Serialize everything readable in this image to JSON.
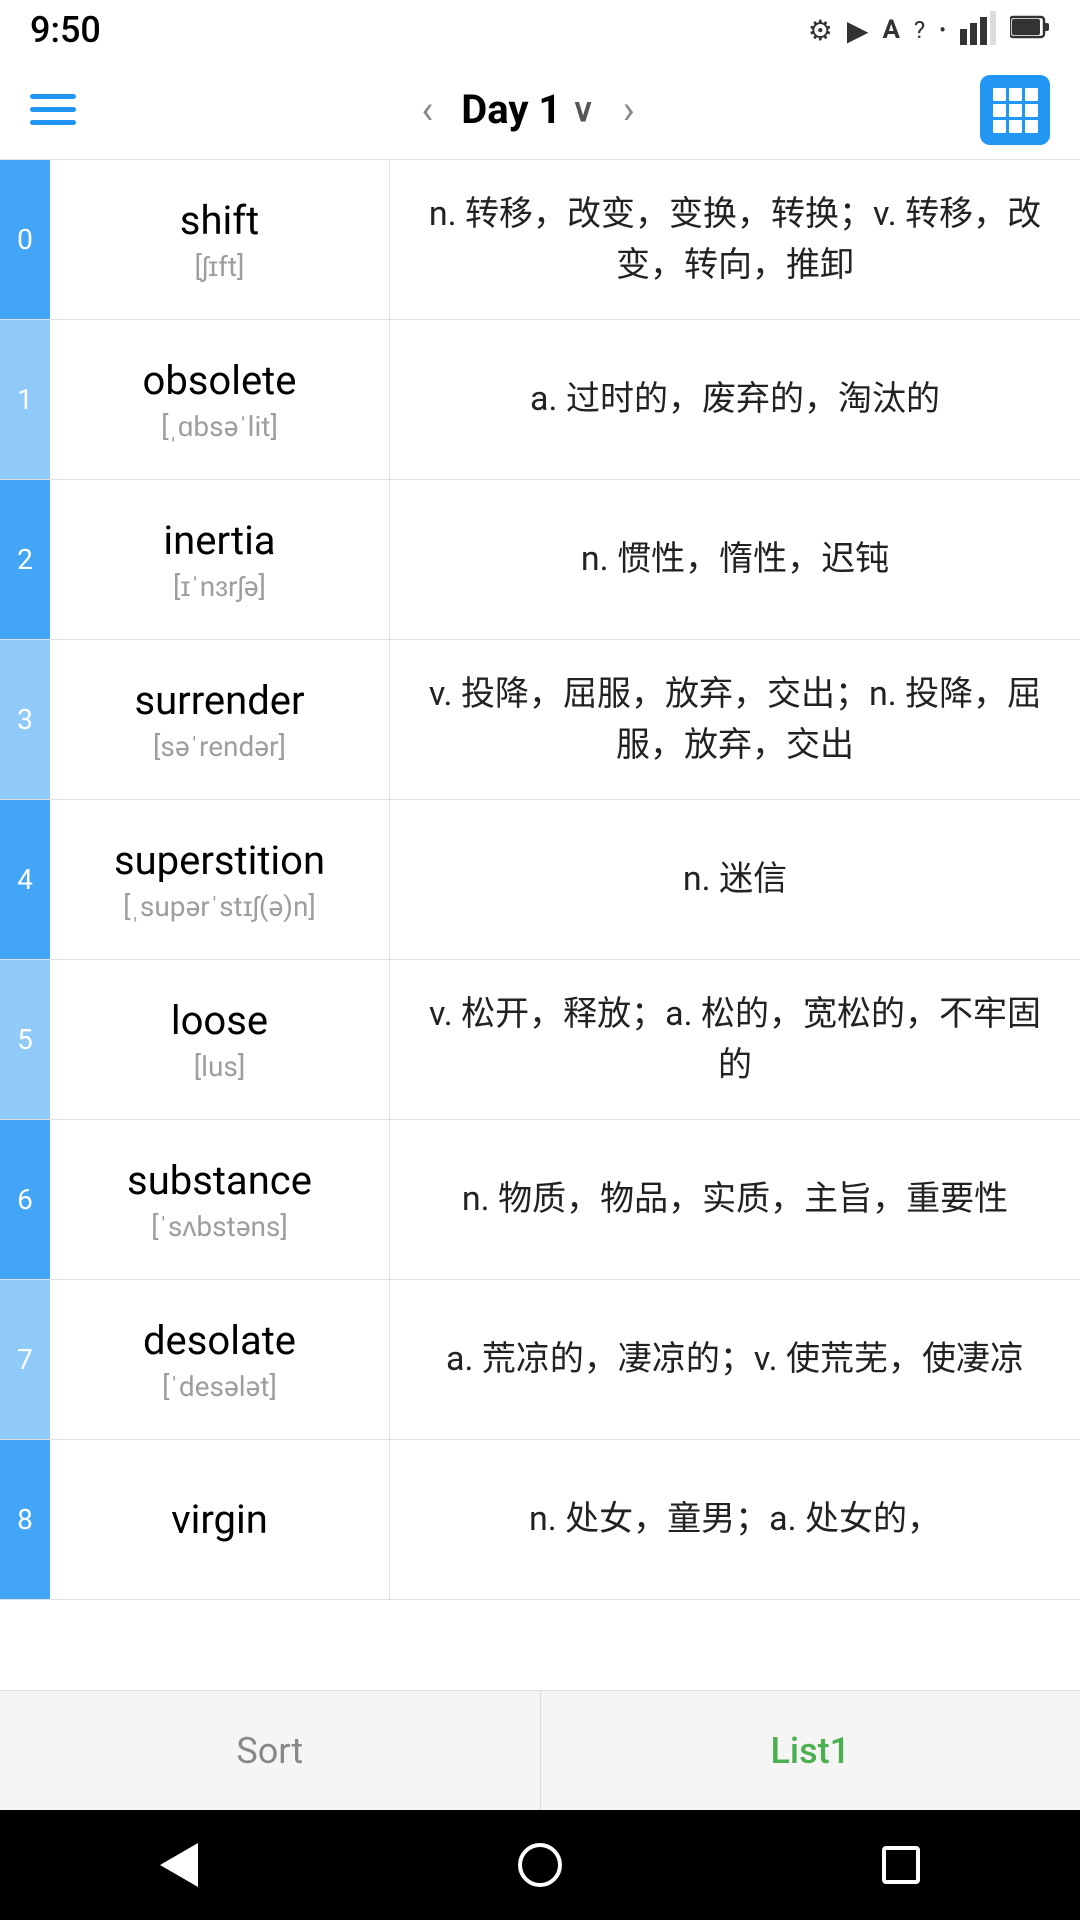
{
  "statusBar": {
    "time": "9:50",
    "icons": [
      "settings",
      "play-protect",
      "font",
      "wifi",
      "signal",
      "battery"
    ]
  },
  "navBar": {
    "title": "Day 1",
    "prevArrow": "‹",
    "nextArrow": "›"
  },
  "words": [
    {
      "index": "0",
      "word": "shift",
      "phonetic": "[ʃɪft]",
      "definition": "n. 转移，改变，变换，转换；v. 转移，改变，转向，推卸"
    },
    {
      "index": "1",
      "word": "obsolete",
      "phonetic": "[ˌɑbsəˈlit]",
      "definition": "a. 过时的，废弃的，淘汰的"
    },
    {
      "index": "2",
      "word": "inertia",
      "phonetic": "[ɪˈnɜrʃə]",
      "definition": "n. 惯性，惰性，迟钝"
    },
    {
      "index": "3",
      "word": "surrender",
      "phonetic": "[səˈrendər]",
      "definition": "v. 投降，屈服，放弃，交出；n. 投降，屈服，放弃，交出"
    },
    {
      "index": "4",
      "word": "superstition",
      "phonetic": "[ˌsupərˈstɪʃ(ə)n]",
      "definition": "n. 迷信"
    },
    {
      "index": "5",
      "word": "loose",
      "phonetic": "[lus]",
      "definition": "v. 松开，释放；a. 松的，宽松的，不牢固的"
    },
    {
      "index": "6",
      "word": "substance",
      "phonetic": "[ˈsʌbstəns]",
      "definition": "n. 物质，物品，实质，主旨，重要性"
    },
    {
      "index": "7",
      "word": "desolate",
      "phonetic": "[ˈdesələt]",
      "definition": "a. 荒凉的，凄凉的；v. 使荒芜，使凄凉"
    },
    {
      "index": "8",
      "word": "virgin",
      "phonetic": "",
      "definition": "n. 处女，童男；a. 处女的，"
    }
  ],
  "bottomTabs": {
    "sort": "Sort",
    "list1": "List1"
  },
  "systemNav": {
    "back": "◀",
    "home": "●",
    "recent": "■"
  }
}
